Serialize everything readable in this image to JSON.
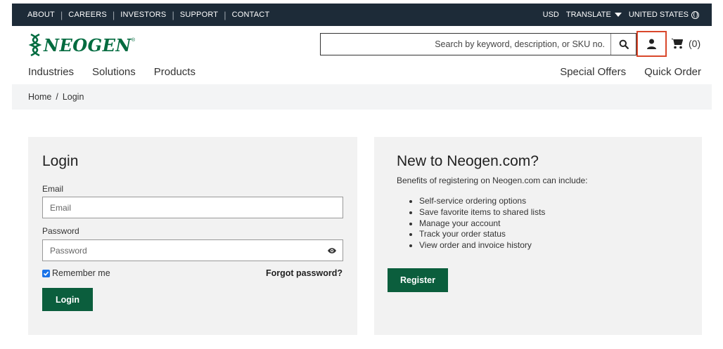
{
  "topbar": {
    "links": [
      "ABOUT",
      "CAREERS",
      "INVESTORS",
      "SUPPORT",
      "CONTACT"
    ],
    "currency": "USD",
    "translate": "TRANSLATE",
    "region": "UNITED STATES"
  },
  "header": {
    "logo_text": "NEOGEN",
    "logo_tm": "®",
    "search_placeholder": "Search by keyword, description, or SKU no.",
    "cart_count": "(0)",
    "highlight_color": "#d9472b"
  },
  "nav": {
    "left": [
      "Industries",
      "Solutions",
      "Products"
    ],
    "right": [
      "Special Offers",
      "Quick Order"
    ]
  },
  "breadcrumb": {
    "home": "Home",
    "separator": "/",
    "current": "Login"
  },
  "login": {
    "title": "Login",
    "email_label": "Email",
    "email_placeholder": "Email",
    "password_label": "Password",
    "password_placeholder": "Password",
    "remember_label": "Remember me",
    "remember_checked": true,
    "forgot_label": "Forgot password?",
    "button_label": "Login"
  },
  "register": {
    "title": "New to Neogen.com?",
    "intro": "Benefits of registering on Neogen.com can include:",
    "benefits": [
      "Self-service ordering options",
      "Save favorite items to shared lists",
      "Manage your account",
      "Track your order status",
      "View order and invoice history"
    ],
    "button_label": "Register"
  },
  "colors": {
    "topbar_bg": "#1d2b38",
    "brand_green": "#006b3f",
    "button_green": "#0b5e3d",
    "card_bg": "#f2f2f2"
  }
}
